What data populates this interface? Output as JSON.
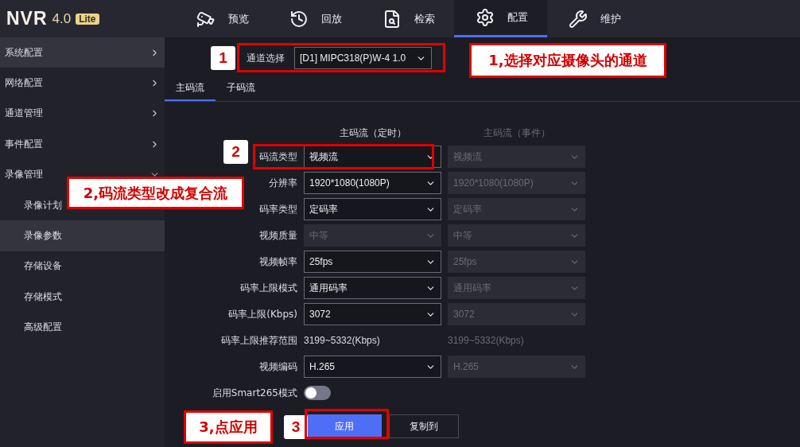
{
  "logo": {
    "name": "NVR",
    "version": "4.0",
    "edition": "Lite"
  },
  "nav": [
    {
      "label": "预览",
      "selected": false
    },
    {
      "label": "回放",
      "selected": false
    },
    {
      "label": "检索",
      "selected": false
    },
    {
      "label": "配置",
      "selected": true
    },
    {
      "label": "维护",
      "selected": false
    }
  ],
  "sidebar": {
    "items": [
      {
        "label": "系统配置",
        "selected": true,
        "expanded": false
      },
      {
        "label": "网络配置",
        "selected": false,
        "expanded": false
      },
      {
        "label": "通道管理",
        "selected": false,
        "expanded": false
      },
      {
        "label": "事件配置",
        "selected": false,
        "expanded": false
      },
      {
        "label": "录像管理",
        "selected": false,
        "expanded": true,
        "children": [
          {
            "label": "录像计划",
            "selected": false
          },
          {
            "label": "录像参数",
            "selected": true
          },
          {
            "label": "存储设备",
            "selected": false
          },
          {
            "label": "存储模式",
            "selected": false
          },
          {
            "label": "高级配置",
            "selected": false
          }
        ]
      }
    ]
  },
  "channel": {
    "label": "通道选择",
    "value": "[D1] MIPC318(P)W-4 1.0"
  },
  "tabs": [
    {
      "label": "主码流",
      "selected": true
    },
    {
      "label": "子码流",
      "selected": false
    }
  ],
  "form": {
    "columns": [
      "主码流（定时）",
      "主码流（事件）"
    ],
    "rows": [
      {
        "kind": "select",
        "label": "码流类型",
        "values": [
          {
            "value": "视频流",
            "disabled": false
          },
          {
            "value": "视频流",
            "disabled": true
          }
        ]
      },
      {
        "kind": "select",
        "label": "分辨率",
        "values": [
          {
            "value": "1920*1080(1080P)",
            "disabled": false
          },
          {
            "value": "1920*1080(1080P)",
            "disabled": true
          }
        ]
      },
      {
        "kind": "select",
        "label": "码率类型",
        "values": [
          {
            "value": "定码率",
            "disabled": false
          },
          {
            "value": "定码率",
            "disabled": true
          }
        ]
      },
      {
        "kind": "select",
        "label": "视频质量",
        "values": [
          {
            "value": "中等",
            "disabled": true
          },
          {
            "value": "中等",
            "disabled": true
          }
        ]
      },
      {
        "kind": "select",
        "label": "视频帧率",
        "values": [
          {
            "value": "25fps",
            "disabled": false
          },
          {
            "value": "25fps",
            "disabled": true
          }
        ]
      },
      {
        "kind": "select",
        "label": "码率上限模式",
        "values": [
          {
            "value": "通用码率",
            "disabled": false
          },
          {
            "value": "通用码率",
            "disabled": true
          }
        ]
      },
      {
        "kind": "select",
        "label": "码率上限(Kbps)",
        "values": [
          {
            "value": "3072",
            "disabled": false
          },
          {
            "value": "3072",
            "disabled": true
          }
        ]
      },
      {
        "kind": "text",
        "label": "码率上限推荐范围",
        "values": [
          {
            "value": "3199~5332(Kbps)",
            "disabled": false
          },
          {
            "value": "3199~5332(Kbps)",
            "disabled": true
          }
        ]
      },
      {
        "kind": "select",
        "label": "视频编码",
        "values": [
          {
            "value": "H.265",
            "disabled": false
          },
          {
            "value": "H.265",
            "disabled": true
          }
        ]
      },
      {
        "kind": "toggle",
        "label": "启用Smart265模式",
        "on": false
      }
    ]
  },
  "buttons": [
    {
      "label": "应用",
      "primary": true
    },
    {
      "label": "复制到",
      "primary": false
    }
  ],
  "annotations": [
    {
      "kind": "outline"
    },
    {
      "kind": "badge",
      "text": "1"
    },
    {
      "kind": "callout",
      "text": "1,选择对应摄像头的通道"
    },
    {
      "kind": "outline"
    },
    {
      "kind": "badge",
      "text": "2"
    },
    {
      "kind": "callout",
      "text": "2,码流类型改成复合流"
    },
    {
      "kind": "callout",
      "text": "3,点应用"
    },
    {
      "kind": "badge",
      "text": "3"
    },
    {
      "kind": "outline"
    }
  ]
}
